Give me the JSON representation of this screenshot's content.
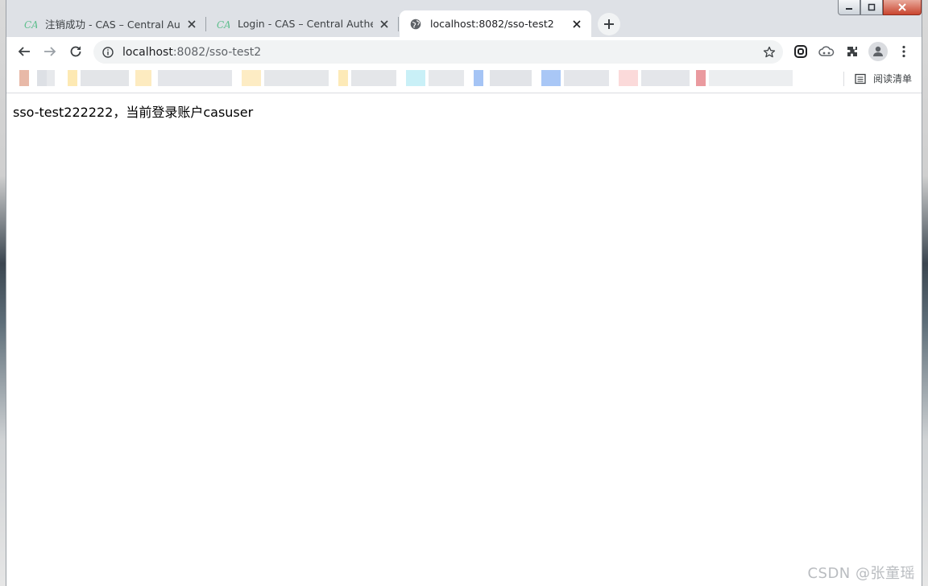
{
  "tabs": [
    {
      "title": "注销成功 - CAS – Central Authe",
      "favicon": "cas-icon",
      "active": false
    },
    {
      "title": "Login - CAS – Central Authenti",
      "favicon": "cas-icon",
      "active": false
    },
    {
      "title": "localhost:8082/sso-test2",
      "favicon": "globe-icon",
      "active": true
    }
  ],
  "address_bar": {
    "host": "localhost",
    "path": ":8082/sso-test2"
  },
  "bookmarks_bar": {
    "reading_list_label": "阅读清单"
  },
  "page": {
    "text": "sso-test222222，当前登录账户casuser"
  },
  "watermark": "CSDN @张童瑶",
  "colors": {
    "tabstrip": "#dee1e6",
    "omnibox": "#f1f3f4",
    "accent": "#5f6368"
  }
}
